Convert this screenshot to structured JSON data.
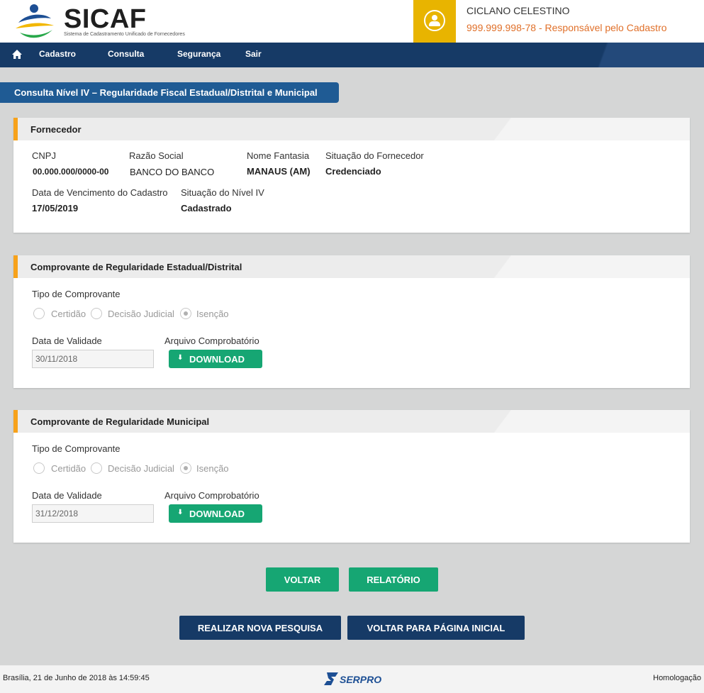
{
  "app": {
    "name": "SICAF",
    "subtitle": "Sistema de Cadastramento Unificado de Fornecedores"
  },
  "user": {
    "name": "CICLANO CELESTINO",
    "role": "999.999.998-78 - Responsável pelo Cadastro",
    "icon": "user-icon"
  },
  "nav": {
    "home_icon": "home-icon",
    "items": [
      {
        "label": "Cadastro"
      },
      {
        "label": "Consulta"
      },
      {
        "label": "Segurança"
      },
      {
        "label": "Sair"
      }
    ]
  },
  "page_title": "Consulta Nível IV – Regularidade Fiscal Estadual/Distrital e Municipal",
  "fornecedor": {
    "title": "Fornecedor",
    "cnpj_label": "CNPJ",
    "cnpj": "00.000.000/0000-00",
    "razao_label": "Razão Social",
    "razao": "BANCO DO BANCO",
    "fantasia_label": "Nome Fantasia",
    "fantasia": "MANAUS (AM)",
    "situacao_label": "Situação do Fornecedor",
    "situacao": "Credenciado",
    "vencimento_label": "Data de Vencimento do Cadastro",
    "vencimento": "17/05/2019",
    "nivel_label": "Situação do Nível IV",
    "nivel": "Cadastrado"
  },
  "estadual": {
    "title": "Comprovante de Regularidade Estadual/Distrital",
    "tipo_label": "Tipo de Comprovante",
    "options": [
      "Certidão",
      "Decisão Judicial",
      "Isenção"
    ],
    "selected": "Isenção",
    "validade_label": "Data de Validade",
    "validade": "30/11/2018",
    "arquivo_label": "Arquivo Comprobatório",
    "download_label": "DOWNLOAD"
  },
  "municipal": {
    "title": "Comprovante de Regularidade Municipal",
    "tipo_label": "Tipo de Comprovante",
    "options": [
      "Certidão",
      "Decisão Judicial",
      "Isenção"
    ],
    "selected": "Isenção",
    "validade_label": "Data de Validade",
    "validade": "31/12/2018",
    "arquivo_label": "Arquivo Comprobatório",
    "download_label": "DOWNLOAD"
  },
  "actions": {
    "voltar": "VOLTAR",
    "relatorio": "RELATÓRIO",
    "nova_pesquisa": "REALIZAR NOVA PESQUISA",
    "pagina_inicial": "VOLTAR PARA PÁGINA INICIAL"
  },
  "footer": {
    "datetime": "Brasília, 21 de Junho de 2018 às 14:59:45",
    "brand": "SERPRO",
    "environment": "Homologação"
  },
  "colors": {
    "navy": "#163a66",
    "green": "#16a673",
    "accent_orange": "#f7a21b",
    "avatar_yellow": "#e8b400",
    "role_orange": "#e0702a"
  }
}
